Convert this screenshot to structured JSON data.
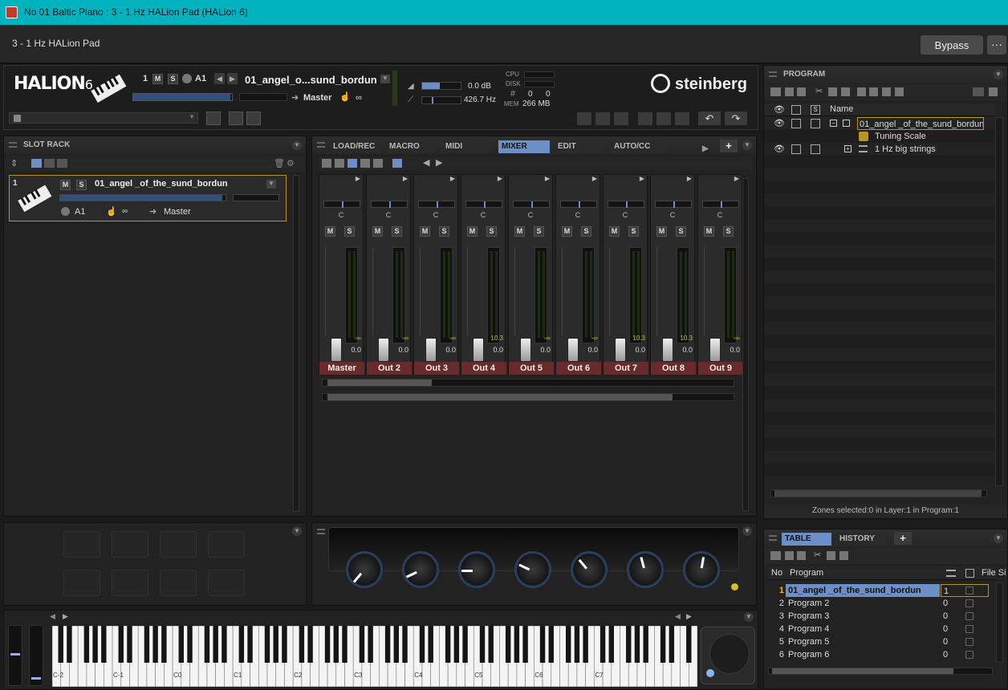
{
  "window": {
    "title": "No 01 Baltic Piano : 3 - 1 Hz HALion Pad (HALion 6)"
  },
  "host": {
    "plugin_name": "3 - 1 Hz HALion Pad",
    "bypass_label": "Bypass",
    "more_label": "···"
  },
  "header": {
    "logo": "HALION",
    "logo_version": "6",
    "slot_number": "1",
    "m": "M",
    "s": "S",
    "midi_channel": "A1",
    "program_name": "01_angel_o...sund_bordun",
    "output": "Master",
    "infinity": "∞",
    "volume": "0.0 dB",
    "tuning": "426.7 Hz",
    "cpu_label": "CPU",
    "disk_label": "DISK",
    "hash_label": "#",
    "mem_label": "MEM",
    "voices_a": "0",
    "voices_b": "0",
    "mem_value": "266 MB",
    "brand": "steinberg"
  },
  "slotrack": {
    "title": "SLOT RACK",
    "slot": {
      "number": "1",
      "m": "M",
      "s": "S",
      "name": "01_angel _of_the_sund_bordun",
      "midi": "A1",
      "infinity": "∞",
      "output": "Master"
    }
  },
  "mixer": {
    "tabs": [
      "LOAD/REC",
      "MACRO",
      "MIDI",
      "MIXER",
      "EDIT",
      "AUTO/CC"
    ],
    "active_tab": "MIXER",
    "add": "+",
    "strips": [
      {
        "pan": "C",
        "m": "M",
        "s": "S",
        "peak": "-∞",
        "level": "0.0",
        "output": "Master"
      },
      {
        "pan": "C",
        "m": "M",
        "s": "S",
        "peak": "-∞",
        "level": "0.0",
        "output": "Out 2"
      },
      {
        "pan": "C",
        "m": "M",
        "s": "S",
        "peak": "-∞",
        "level": "0.0",
        "output": "Out 3"
      },
      {
        "pan": "C",
        "m": "M",
        "s": "S",
        "peak": "10.3",
        "level": "0.0",
        "output": "Out 4"
      },
      {
        "pan": "C",
        "m": "M",
        "s": "S",
        "peak": "-∞",
        "level": "0.0",
        "output": "Out 5"
      },
      {
        "pan": "C",
        "m": "M",
        "s": "S",
        "peak": "-∞",
        "level": "0.0",
        "output": "Out 6"
      },
      {
        "pan": "C",
        "m": "M",
        "s": "S",
        "peak": "10.3",
        "level": "0.0",
        "output": "Out 7"
      },
      {
        "pan": "C",
        "m": "M",
        "s": "S",
        "peak": "10.3",
        "level": "0.0",
        "output": "Out 8"
      },
      {
        "pan": "C",
        "m": "M",
        "s": "S",
        "peak": "-∞",
        "level": "0.0",
        "output": "Out 9"
      }
    ]
  },
  "program": {
    "title": "PROGRAM",
    "column_name": "Name",
    "tree": [
      {
        "name": "01_angel _of_the_sund_bordun",
        "level": 0,
        "expander": "−"
      },
      {
        "name": "Tuning Scale",
        "level": 1,
        "expander": ""
      },
      {
        "name": "1 Hz big strings",
        "level": 1,
        "expander": "+"
      }
    ],
    "status": "Zones selected:0 in Layer:1 in Program:1"
  },
  "table": {
    "tabs": [
      "TABLE",
      "HISTORY"
    ],
    "add": "+",
    "columns": [
      "No",
      "Program",
      "File Si"
    ],
    "rows": [
      {
        "no": "1",
        "program": "01_angel _of_the_sund_bordun",
        "slot": "1"
      },
      {
        "no": "2",
        "program": "Program 2",
        "slot": "0"
      },
      {
        "no": "3",
        "program": "Program 3",
        "slot": "0"
      },
      {
        "no": "4",
        "program": "Program 4",
        "slot": "0"
      },
      {
        "no": "5",
        "program": "Program 5",
        "slot": "0"
      },
      {
        "no": "6",
        "program": "Program 6",
        "slot": "0"
      }
    ]
  },
  "keyboard": {
    "octaves": [
      "C-2",
      "C-1",
      "C0",
      "C1",
      "C2",
      "C3",
      "C4",
      "C5",
      "C6",
      "C7"
    ]
  },
  "macro": {
    "knob_count": 7
  }
}
